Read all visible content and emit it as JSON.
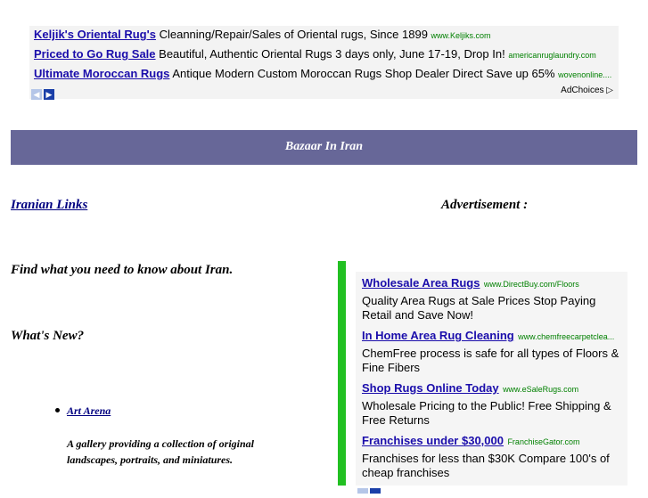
{
  "top_ad": {
    "rows": [
      {
        "title": "Keljik's Oriental Rug's",
        "text": "Cleanning/Repair/Sales of Oriental rugs, Since 1899",
        "url": "www.Keljiks.com"
      },
      {
        "title": "Priced to Go Rug Sale",
        "text": "Beautiful, Authentic Oriental Rugs 3 days only, June 17-19, Drop In!",
        "url": "americanruglaundry.com"
      },
      {
        "title": "Ultimate Moroccan Rugs",
        "text": "Antique Modern Custom Moroccan Rugs Shop Dealer Direct Save up 65%",
        "url": "wovenonline...."
      }
    ],
    "prev_glyph": "◀",
    "next_glyph": "▶",
    "adchoices": "AdChoices ▷"
  },
  "banner": {
    "title": "Bazaar In Iran",
    "color": "#676798"
  },
  "iranian_links": "Iranian Links",
  "advertisement_label": "Advertisement :",
  "find_text": "Find what you need to know about Iran.",
  "whats_new": "What's New?",
  "art_arena": {
    "link": "Art Arena",
    "description": "A gallery providing a collection of original landscapes, portraits, and miniatures."
  },
  "side_ad": {
    "items": [
      {
        "title": "Wholesale Area Rugs",
        "url": "www.DirectBuy.com/Floors",
        "desc": "Quality Area Rugs at Sale Prices Stop Paying Retail and Save Now!"
      },
      {
        "title": "In Home Area Rug Cleaning",
        "url": "www.chemfreecarpetclea...",
        "desc": "ChemFree process is safe for all types of Floors & Fine Fibers"
      },
      {
        "title": "Shop Rugs Online Today",
        "url": "www.eSaleRugs.com",
        "desc": "Wholesale Pricing to the Public! Free Shipping & Free Returns"
      },
      {
        "title": "Franchises under $30,000",
        "url": "FranchiseGator.com",
        "desc": "Franchises for less than $30K Compare 100's of cheap franchises"
      }
    ]
  }
}
